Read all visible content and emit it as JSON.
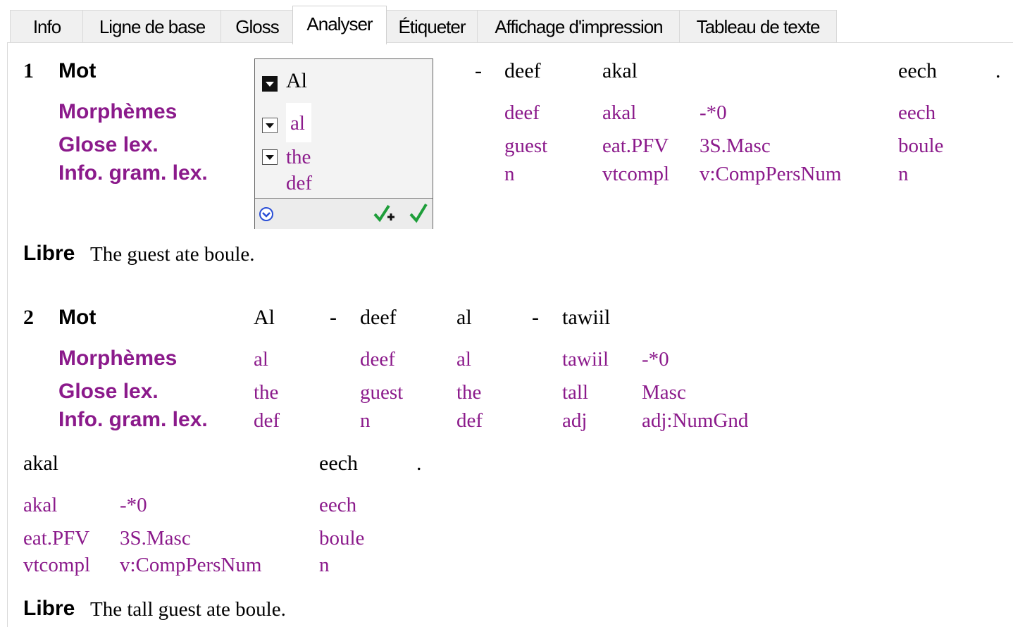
{
  "tabs": [
    {
      "label": "Info"
    },
    {
      "label": "Ligne de base"
    },
    {
      "label": "Gloss"
    },
    {
      "label": "Analyser"
    },
    {
      "label": "Étiqueter"
    },
    {
      "label": "Affichage d'impression"
    },
    {
      "label": "Tableau de texte"
    }
  ],
  "active_tab": "Analyser",
  "labels": {
    "mot": "Mot",
    "morphemes": "Morphèmes",
    "glose": "Glose lex.",
    "info": "Info. gram. lex.",
    "libre": "Libre"
  },
  "s1": {
    "num": "1",
    "popup": {
      "word": "Al",
      "morph": "al",
      "gloss": "the",
      "gram": "def"
    },
    "words": [
      {
        "w": "-"
      },
      {
        "w": "deef"
      },
      {
        "w": "akal"
      },
      {
        "w": "eech"
      },
      {
        "w": "."
      }
    ],
    "morphs": [
      {
        "m": "deef",
        "g": "guest",
        "i": "n"
      },
      {
        "m": "akal",
        "g": "eat.PFV",
        "i": "vtcompl"
      },
      {
        "m": "-*0",
        "g": "3S.Masc",
        "i": "v:CompPersNum"
      },
      {
        "m": "eech",
        "g": "boule",
        "i": "n"
      }
    ],
    "free": "The guest ate boule."
  },
  "s2": {
    "num": "2",
    "words": [
      {
        "w": "Al"
      },
      {
        "w": "-"
      },
      {
        "w": "deef"
      },
      {
        "w": "al"
      },
      {
        "w": "-"
      },
      {
        "w": "tawiil"
      }
    ],
    "morphs": [
      {
        "m": "al",
        "g": "the",
        "i": "def"
      },
      {
        "m": "deef",
        "g": "guest",
        "i": "n"
      },
      {
        "m": "al",
        "g": "the",
        "i": "def"
      },
      {
        "m": "tawiil",
        "g": "tall",
        "i": "adj"
      },
      {
        "m": "-*0",
        "g": "Masc",
        "i": "adj:NumGnd"
      }
    ],
    "words2": [
      {
        "w": "akal"
      },
      {
        "w": "eech"
      },
      {
        "w": "."
      }
    ],
    "morphs2": [
      {
        "m": "akal",
        "g": "eat.PFV",
        "i": "vtcompl"
      },
      {
        "m": "-*0",
        "g": "3S.Masc",
        "i": "v:CompPersNum"
      },
      {
        "m": "eech",
        "g": "boule",
        "i": "n"
      }
    ],
    "free": "The tall guest ate boule."
  },
  "colors": {
    "purple": "#8b1a8b",
    "approve": "#1e9e3a",
    "menu_icon": "#2a4fd6"
  },
  "icons": [
    "dropdown-icon",
    "menu-circle-icon",
    "approve-add-icon",
    "approve-icon"
  ]
}
